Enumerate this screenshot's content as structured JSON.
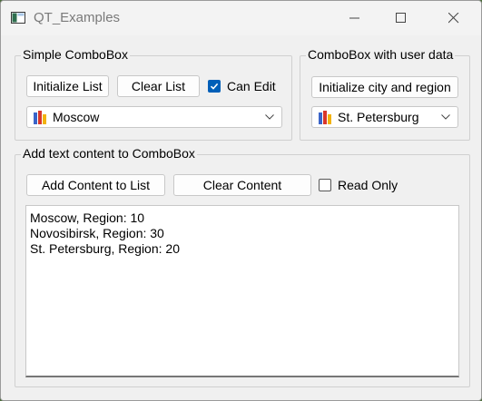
{
  "window": {
    "title": "QT_Examples",
    "app_icon": "qt-window-icon"
  },
  "titlebar_buttons": {
    "minimize": "minimize-icon",
    "maximize": "maximize-icon",
    "close": "close-icon"
  },
  "simple_group": {
    "title": "Simple ComboBox",
    "init_button": "Initialize List",
    "clear_button": "Clear List",
    "can_edit_label": "Can Edit",
    "can_edit_checked": true,
    "combo_value": "Moscow",
    "combo_icon": "city-flag-icon"
  },
  "userdata_group": {
    "title": "ComboBox with user data",
    "init_button": "Initialize city and region",
    "combo_value": "St. Petersburg",
    "combo_icon": "city-flag-icon"
  },
  "text_group": {
    "title": "Add text content to ComboBox",
    "add_button": "Add Content to List",
    "clear_button": "Clear Content",
    "read_only_label": "Read Only",
    "read_only_checked": false,
    "lines": [
      "Moscow, Region: 10",
      "Novosibirsk, Region: 30",
      "St. Petersburg, Region: 20"
    ]
  },
  "colors": {
    "accent": "#005fb8",
    "flag_red": "#d9362b",
    "flag_blue": "#3b64c8",
    "flag_yellow": "#f2b20e"
  }
}
